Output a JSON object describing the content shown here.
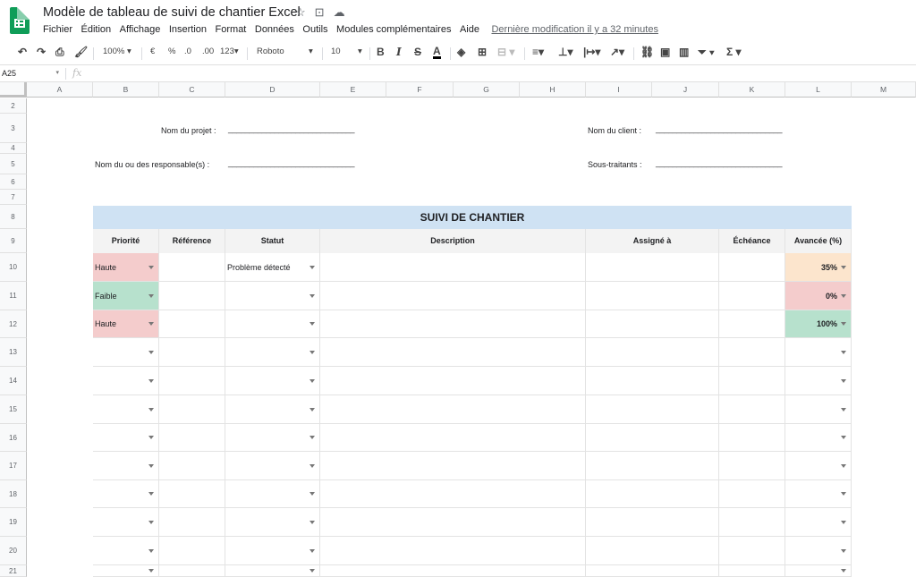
{
  "doc": {
    "title": "Modèle de tableau de suivi de chantier Excel",
    "star_icon": "star-icon",
    "folder_icon": "move-to-folder-icon",
    "cloud_icon": "cloud-status-icon"
  },
  "menu": {
    "items": [
      "Fichier",
      "Édition",
      "Affichage",
      "Insertion",
      "Format",
      "Données",
      "Outils",
      "Modules complémentaires",
      "Aide"
    ],
    "last_edit": "Dernière modification il y a 32 minutes"
  },
  "toolbar": {
    "zoom": "100%",
    "currency": "€",
    "percent": "%",
    "dec_less": ".0",
    "dec_more": ".00",
    "format_more": "123",
    "font": "Roboto",
    "font_size": "10",
    "bold": "B",
    "italic": "I",
    "strike": "S",
    "text_color": "A",
    "sum": "Σ"
  },
  "formula": {
    "cell_ref": "A25",
    "fx": "fx"
  },
  "columns": [
    "A",
    "B",
    "C",
    "D",
    "E",
    "F",
    "G",
    "H",
    "I",
    "J",
    "K",
    "L",
    "M"
  ],
  "rows": [
    "2",
    "3",
    "4",
    "5",
    "6",
    "7",
    "8",
    "9",
    "10",
    "11",
    "12",
    "13",
    "14",
    "15",
    "16",
    "17",
    "18",
    "19",
    "20",
    "21"
  ],
  "form": {
    "project_label": "Nom du projet :",
    "project_line": "______________________________",
    "client_label": "Nom du client :",
    "client_line": "______________________________",
    "managers_label": "Nom du ou des responsable(s) :",
    "managers_line": "______________________________",
    "subcontractors_label": "Sous-traitants :",
    "subcontractors_line": "______________________________"
  },
  "table": {
    "banner": "SUIVI DE CHANTIER",
    "headers": [
      "Priorité",
      "Référence",
      "Statut",
      "Description",
      "Assigné à",
      "Échéance",
      "Avancée (%)"
    ],
    "rows": [
      {
        "priority": "Haute",
        "priority_color": "#f4cccc",
        "status": "Problème détecté",
        "progress": "35%",
        "progress_color": "#fce5cd"
      },
      {
        "priority": "Faible",
        "priority_color": "#b7e1cd",
        "status": "",
        "progress": "0%",
        "progress_color": "#f4cccc"
      },
      {
        "priority": "Haute",
        "priority_color": "#f4cccc",
        "status": "",
        "progress": "100%",
        "progress_color": "#b7e1cd"
      }
    ]
  }
}
